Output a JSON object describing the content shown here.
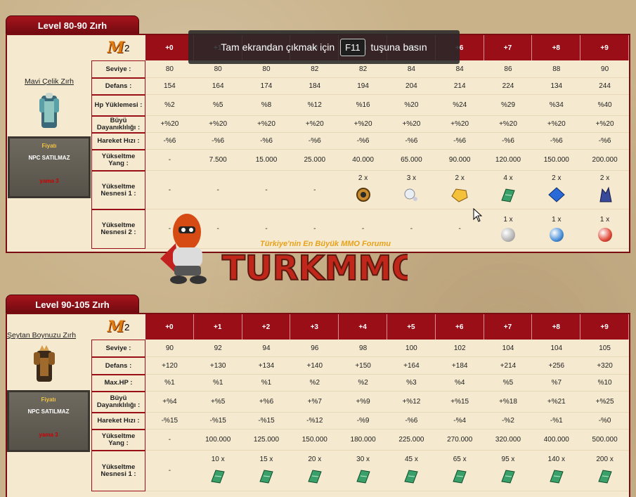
{
  "levels_header": [
    "+0",
    "+1",
    "+2",
    "+3",
    "+4",
    "+5",
    "+6",
    "+7",
    "+8",
    "+9"
  ],
  "overlay": {
    "before": "Tam ekrandan çıkmak için",
    "key": "F11",
    "after": "tuşuna basın"
  },
  "logo_text": "M",
  "logo_sub": "2",
  "watermark": {
    "slogan": "Türkiye'nin En Büyük MMO Forumu",
    "brand": "TURKMMO"
  },
  "section1": {
    "title": "Level 80-90 Zırh",
    "item_name": "Mavi Çelik Zırh",
    "price_label": "Fiyatı",
    "price_value": "NPC SATILMAZ",
    "price_tag": "yama 3",
    "rows": [
      {
        "label": "Seviye :",
        "values": [
          "80",
          "80",
          "80",
          "82",
          "82",
          "84",
          "84",
          "86",
          "88",
          "90"
        ]
      },
      {
        "label": "Defans :",
        "values": [
          "154",
          "164",
          "174",
          "184",
          "194",
          "204",
          "214",
          "224",
          "134",
          "244"
        ]
      },
      {
        "label": "Hp Yüklemesi :",
        "values": [
          "%2",
          "%5",
          "%8",
          "%12",
          "%16",
          "%20",
          "%24",
          "%29",
          "%34",
          "%40"
        ]
      },
      {
        "label": "Büyü Dayanıklılığı :",
        "values": [
          "+%20",
          "+%20",
          "+%20",
          "+%20",
          "+%20",
          "+%20",
          "+%20",
          "+%20",
          "+%20",
          "+%20"
        ]
      },
      {
        "label": "Hareket Hızı :",
        "values": [
          "-%6",
          "-%6",
          "-%6",
          "-%6",
          "-%6",
          "-%6",
          "-%6",
          "-%6",
          "-%6",
          "-%6"
        ]
      },
      {
        "label": "Yükseltme Yang :",
        "values": [
          "-",
          "7.500",
          "15.000",
          "25.000",
          "40.000",
          "65.000",
          "90.000",
          "120.000",
          "150.000",
          "200.000"
        ]
      }
    ],
    "material1_label": "Yükseltme Nesnesi 1 :",
    "material1": [
      {
        "count": "",
        "dash": "-",
        "icon": ""
      },
      {
        "count": "",
        "dash": "-",
        "icon": ""
      },
      {
        "count": "",
        "dash": "-",
        "icon": ""
      },
      {
        "count": "",
        "dash": "-",
        "icon": ""
      },
      {
        "count": "2 x",
        "dash": "",
        "icon": "gear-ring-icon"
      },
      {
        "count": "3 x",
        "dash": "",
        "icon": "pearl-icon"
      },
      {
        "count": "2 x",
        "dash": "",
        "icon": "gold-stone-icon"
      },
      {
        "count": "4 x",
        "dash": "",
        "icon": "green-scroll-icon"
      },
      {
        "count": "2 x",
        "dash": "",
        "icon": "blue-gem-icon"
      },
      {
        "count": "2 x",
        "dash": "",
        "icon": "crystal-icon"
      }
    ],
    "material2_label": "Yükseltme Nesnesi 2 :",
    "material2": [
      {
        "count": "",
        "dash": "-",
        "icon": ""
      },
      {
        "count": "",
        "dash": "-",
        "icon": ""
      },
      {
        "count": "",
        "dash": "-",
        "icon": ""
      },
      {
        "count": "",
        "dash": "-",
        "icon": ""
      },
      {
        "count": "",
        "dash": "-",
        "icon": ""
      },
      {
        "count": "",
        "dash": "-",
        "icon": ""
      },
      {
        "count": "",
        "dash": "-",
        "icon": ""
      },
      {
        "count": "1 x",
        "dash": "",
        "icon": "white-orb-icon"
      },
      {
        "count": "1 x",
        "dash": "",
        "icon": "blue-orb-icon"
      },
      {
        "count": "1 x",
        "dash": "",
        "icon": "red-orb-icon"
      }
    ]
  },
  "section2": {
    "title": "Level 90-105 Zırh",
    "item_name": "Şeytan Boynuzu Zırh",
    "price_label": "Fiyatı",
    "price_value": "NPC SATILMAZ",
    "price_tag": "yama 3",
    "rows": [
      {
        "label": "Seviye :",
        "values": [
          "90",
          "92",
          "94",
          "96",
          "98",
          "100",
          "102",
          "104",
          "104",
          "105"
        ]
      },
      {
        "label": "Defans :",
        "values": [
          "+120",
          "+130",
          "+134",
          "+140",
          "+150",
          "+164",
          "+184",
          "+214",
          "+256",
          "+320"
        ]
      },
      {
        "label": "Max.HP :",
        "values": [
          "%1",
          "%1",
          "%1",
          "%2",
          "%2",
          "%3",
          "%4",
          "%5",
          "%7",
          "%10"
        ]
      },
      {
        "label": "Büyü Dayanıklılığı :",
        "values": [
          "+%4",
          "+%5",
          "+%6",
          "+%7",
          "+%9",
          "+%12",
          "+%15",
          "+%18",
          "+%21",
          "+%25"
        ]
      },
      {
        "label": "Hareket Hızı :",
        "values": [
          "-%15",
          "-%15",
          "-%15",
          "-%12",
          "-%9",
          "-%6",
          "-%4",
          "-%2",
          "-%1",
          "-%0"
        ]
      },
      {
        "label": "Yükseltme Yang :",
        "values": [
          "-",
          "100.000",
          "125.000",
          "150.000",
          "180.000",
          "225.000",
          "270.000",
          "320.000",
          "400.000",
          "500.000"
        ]
      }
    ],
    "material1_label": "Yükseltme Nesnesi 1 :",
    "material1": [
      {
        "count": "",
        "dash": "-",
        "icon": ""
      },
      {
        "count": "10 x",
        "dash": "",
        "icon": "green-scroll-icon"
      },
      {
        "count": "15 x",
        "dash": "",
        "icon": "green-scroll-icon"
      },
      {
        "count": "20 x",
        "dash": "",
        "icon": "green-scroll-icon"
      },
      {
        "count": "30 x",
        "dash": "",
        "icon": "green-scroll-icon"
      },
      {
        "count": "45 x",
        "dash": "",
        "icon": "green-scroll-icon"
      },
      {
        "count": "65 x",
        "dash": "",
        "icon": "green-scroll-icon"
      },
      {
        "count": "95 x",
        "dash": "",
        "icon": "green-scroll-icon"
      },
      {
        "count": "140 x",
        "dash": "",
        "icon": "green-scroll-icon"
      },
      {
        "count": "200 x",
        "dash": "",
        "icon": "green-scroll-icon"
      }
    ]
  }
}
